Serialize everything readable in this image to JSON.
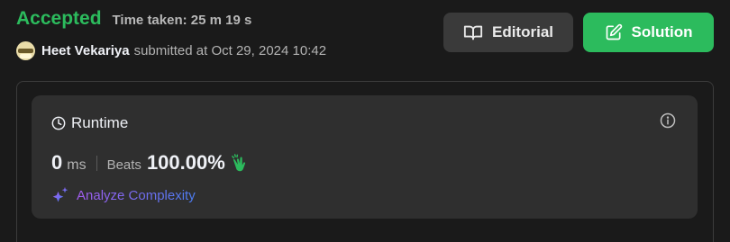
{
  "submission": {
    "status": "Accepted",
    "time_taken": "Time taken: 25 m 19 s",
    "user_name": "Heet Vekariya",
    "submitted_text": "submitted at Oct 29, 2024 10:42"
  },
  "buttons": {
    "editorial_label": "Editorial",
    "solution_label": "Solution"
  },
  "runtime_card": {
    "title": "Runtime",
    "value": "0",
    "unit": "ms",
    "beats_label": "Beats",
    "beats_value": "100.00%",
    "analyze_label": "Analyze Complexity"
  },
  "icons": {
    "editorial": "book-open-icon",
    "solution": "edit-square-icon",
    "runtime": "clock-icon",
    "info": "info-circle-icon",
    "beats": "clapping-hands-icon",
    "analyze": "sparkle-icon"
  },
  "colors": {
    "accepted": "#2cbb5d",
    "solution_button": "#2cbb5d",
    "editorial_button": "#3a3a3a",
    "analyze_gradient_start": "#a45cf0",
    "analyze_gradient_end": "#4a7cf0"
  }
}
